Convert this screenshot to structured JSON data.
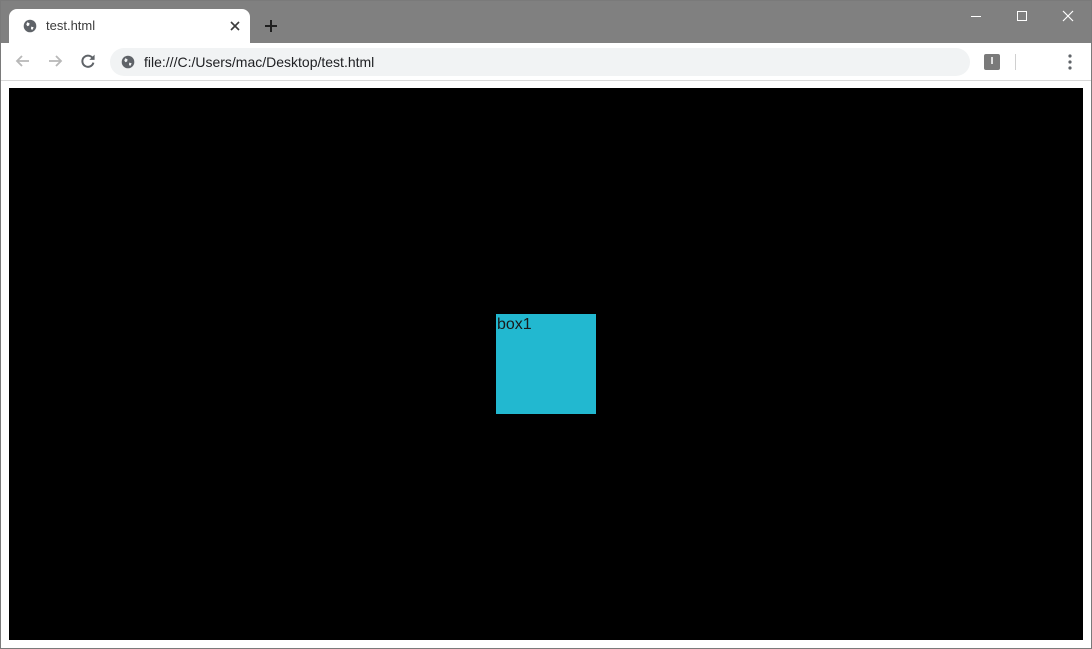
{
  "browser": {
    "tab": {
      "title": "test.html"
    },
    "address_bar": {
      "url": "file:///C:/Users/mac/Desktop/test.html"
    },
    "extension_icon_label": "I",
    "icons": {
      "tab": "globe-icon",
      "tab_close": "close-icon",
      "new_tab": "plus-icon",
      "back": "arrow-left-icon",
      "forward": "arrow-right-icon",
      "reload": "reload-icon",
      "site_info": "globe-icon",
      "menu": "kebab-menu-icon",
      "minimize": "minimize-icon",
      "maximize": "maximize-icon",
      "window_close": "close-icon"
    }
  },
  "page": {
    "background_color": "#000000",
    "box1": {
      "label": "box1",
      "color": "#22b8d0"
    }
  },
  "colors": {
    "titlebar": "#808080",
    "toolbar": "#ffffff",
    "omnibox": "#f1f3f4"
  }
}
